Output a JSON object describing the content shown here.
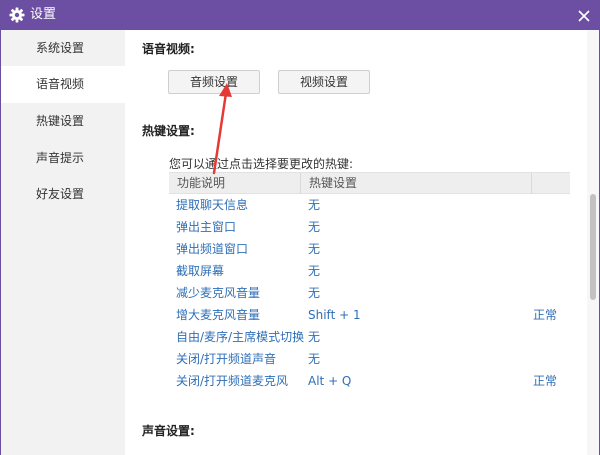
{
  "window": {
    "title": "设置",
    "title_icon": "gear-icon",
    "close_icon": "close-icon",
    "accent": "#6c4fa3"
  },
  "sidebar": {
    "items": [
      {
        "label": "系统设置",
        "active": false
      },
      {
        "label": "语音视频",
        "active": true
      },
      {
        "label": "热键设置",
        "active": false
      },
      {
        "label": "声音提示",
        "active": false
      },
      {
        "label": "好友设置",
        "active": false
      }
    ]
  },
  "voice_video": {
    "title": "语音视频:",
    "audio_button": "音频设置",
    "video_button": "视频设置"
  },
  "hotkeys": {
    "title": "热键设置:",
    "hint": "您可以通过点击选择要更改的热键:",
    "columns": [
      "功能说明",
      "热键设置"
    ],
    "rows": [
      {
        "function": "提取聊天信息",
        "hotkey": "无",
        "status": ""
      },
      {
        "function": "弹出主窗口",
        "hotkey": "无",
        "status": ""
      },
      {
        "function": "弹出频道窗口",
        "hotkey": "无",
        "status": ""
      },
      {
        "function": "截取屏幕",
        "hotkey": "无",
        "status": ""
      },
      {
        "function": "减少麦克风音量",
        "hotkey": "无",
        "status": ""
      },
      {
        "function": "增大麦克风音量",
        "hotkey": "Shift + 1",
        "status": "正常"
      },
      {
        "function": "自由/麦序/主席模式切换",
        "hotkey": "无",
        "status": ""
      },
      {
        "function": "关闭/打开频道声音",
        "hotkey": "无",
        "status": ""
      },
      {
        "function": "关闭/打开频道麦克风",
        "hotkey": "Alt + Q",
        "status": "正常"
      }
    ],
    "link_color": "#2f6fb7"
  },
  "sound": {
    "title": "声音设置:"
  },
  "annotation": {
    "arrow_color": "#e53935"
  }
}
